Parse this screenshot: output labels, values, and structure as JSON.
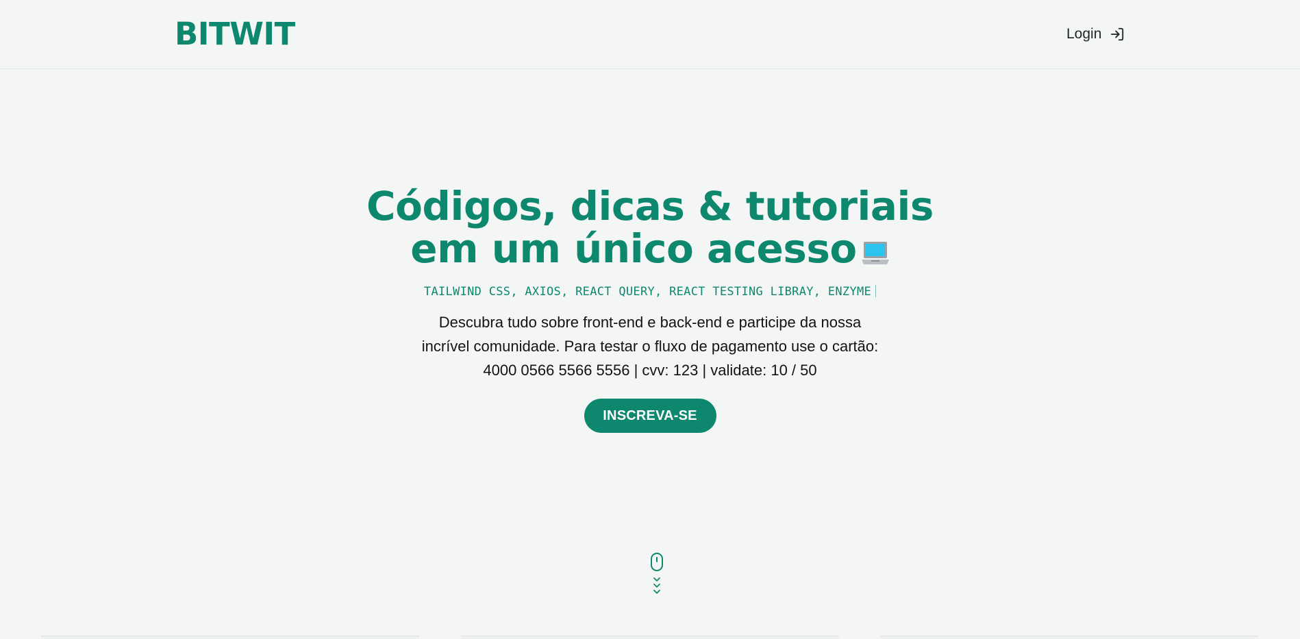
{
  "header": {
    "logo": "BITWIT",
    "login_label": "Login",
    "login_icon": "sign-in-icon"
  },
  "hero": {
    "title": "Códigos, dicas & tutoriais em um único acesso",
    "title_icon": "laptop-emoji-icon",
    "typing_text": "TAILWIND CSS, AXIOS, REACT QUERY, REACT TESTING LIBRAY, ENZYME",
    "description_line1": "Descubra tudo sobre front-end e back-end e participe da nossa",
    "description_line2": "incrível comunidade. Para testar o fluxo de pagamento use o cartão:",
    "description_line3": "4000 0566 5566 5556 | cvv: 123 | validate: 10 / 50",
    "cta_label": "INSCREVA-SE"
  },
  "scroll": {
    "icon": "mouse-scroll-icon",
    "arrows_icon": "chevrons-down-icon"
  },
  "colors": {
    "accent": "#0e876f",
    "background": "#f4f6f5",
    "text": "#111314"
  }
}
